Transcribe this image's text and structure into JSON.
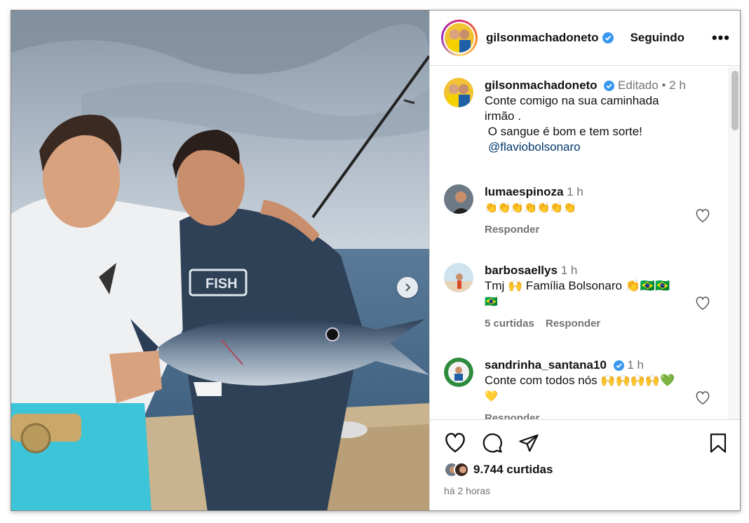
{
  "post": {
    "author": "gilsonmachadoneto",
    "follow_label": "Seguindo",
    "more_label": "•••"
  },
  "caption": {
    "username": "gilsonmachadoneto",
    "edited": "Editado",
    "dot": "•",
    "time": "2 h",
    "line1": "Conte comigo na sua caminhada",
    "line2": "irmão .",
    "line3": " O sangue é bom e tem sorte!",
    "mention": "@flaviobolsonaro"
  },
  "comments": [
    {
      "username": "lumaespinoza",
      "time": "1 h",
      "text": "👏👏👏👏👏👏👏",
      "reply": "Responder"
    },
    {
      "username": "barbosaellys",
      "time": "1 h",
      "text": "Tmj 🙌 Família Bolsonaro 👏🇧🇷🇧🇷",
      "text2": "🇧🇷",
      "likes": "5 curtidas",
      "reply": "Responder"
    },
    {
      "username": "sandrinha_santana10",
      "time": "1 h",
      "text": "Conte com todos nós 🙌🙌🙌🙌💚",
      "text2": "💛",
      "likes": "Responder",
      "reply": "Responder"
    }
  ],
  "footer": {
    "likes": "9.744 curtidas",
    "time": "há 2 horas"
  },
  "photo": {
    "shirt_text": "FISH"
  },
  "colors": {
    "verified": "#3897f0",
    "link": "#00376b",
    "meta": "#737373"
  }
}
